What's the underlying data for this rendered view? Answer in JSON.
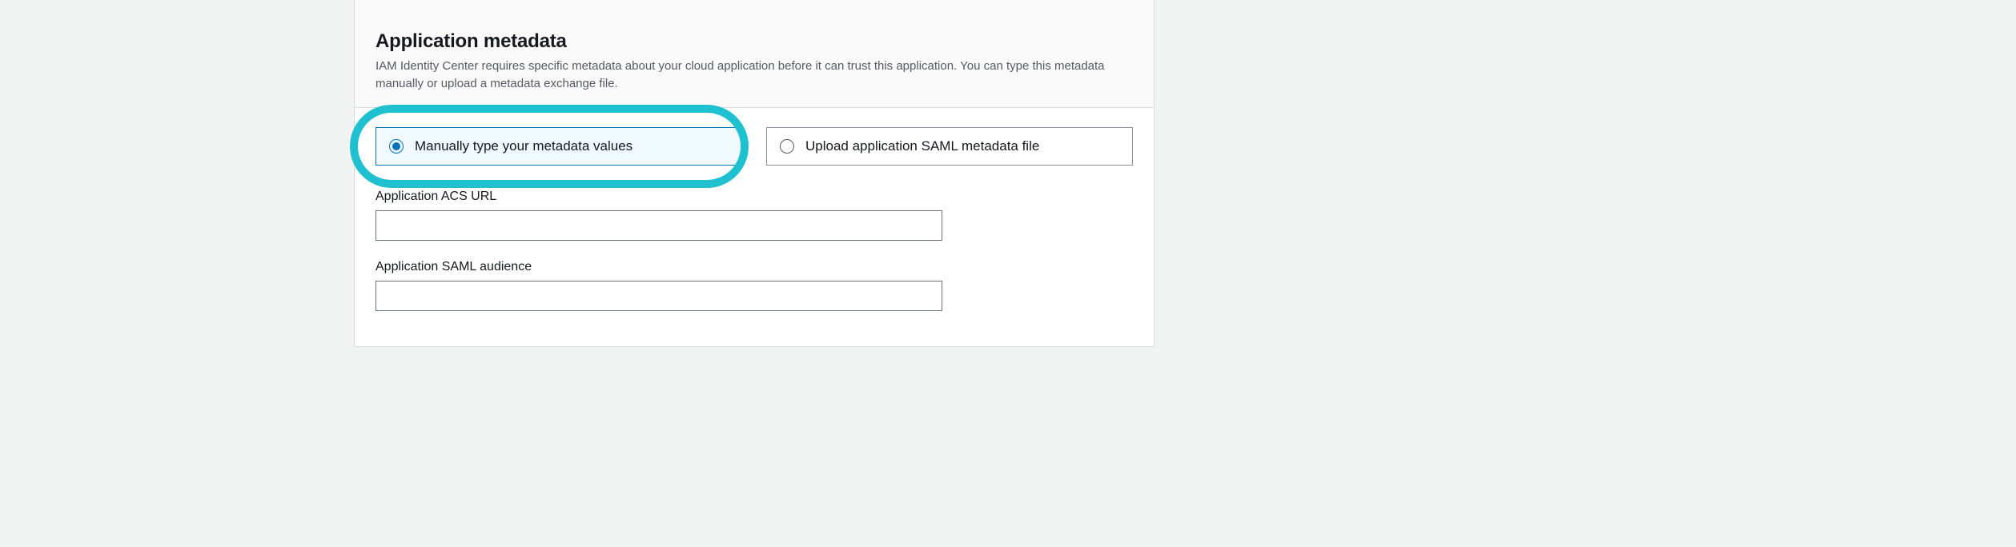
{
  "panel": {
    "title": "Application metadata",
    "description": "IAM Identity Center requires specific metadata about your cloud application before it can trust this application. You can type this metadata manually or upload a metadata exchange file."
  },
  "options": {
    "manual": {
      "label": "Manually type your metadata values",
      "selected": true
    },
    "upload": {
      "label": "Upload application SAML metadata file",
      "selected": false
    }
  },
  "fields": {
    "acs_url": {
      "label": "Application ACS URL",
      "value": ""
    },
    "saml_audience": {
      "label": "Application SAML audience",
      "value": ""
    }
  }
}
